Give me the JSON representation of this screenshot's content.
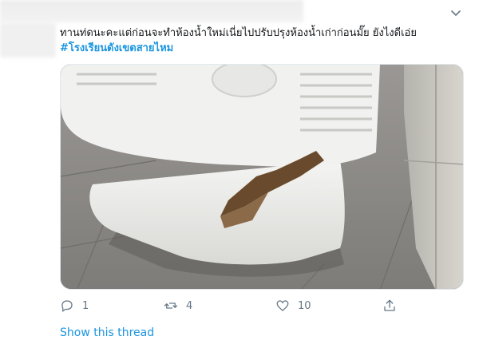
{
  "tweet": {
    "text": "ทานท่ดนะคะแต่ก่อนจะทำห้องน้ำใหม่เนี่ยไปปรับปรุงห้องน้ำเก่าก่อนมั๊ย ยังไงดีเอ่ย",
    "hashtag": "#โรงเรียนดังเขตสายไหม"
  },
  "actions": {
    "reply_count": "1",
    "retweet_count": "4",
    "like_count": "10"
  },
  "show_thread_label": "Show this thread",
  "icons": [
    "caret-down-icon",
    "reply-icon",
    "retweet-icon",
    "like-icon",
    "share-icon"
  ],
  "colors": {
    "link": "#1b95e0",
    "muted": "#657786"
  }
}
